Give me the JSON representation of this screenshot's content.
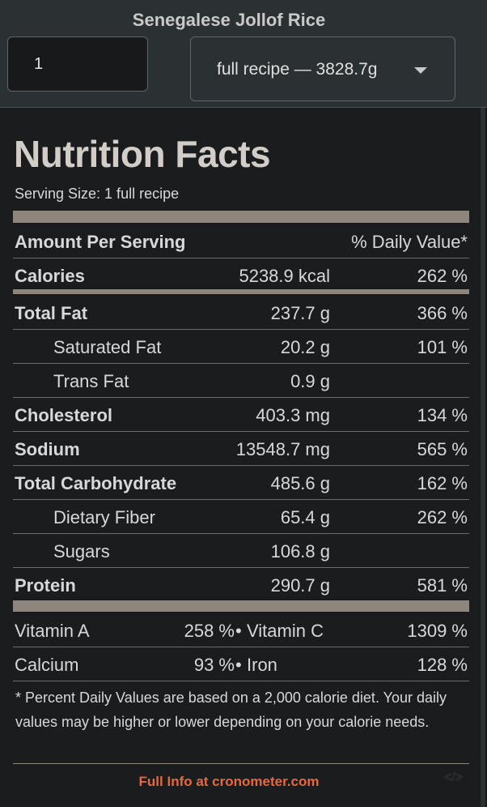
{
  "recipe_title": "Senegalese Jollof Rice",
  "quantity": "1",
  "unit_selected": "full recipe — 3828.7g",
  "label": {
    "title": "Nutrition Facts",
    "serving_size": "Serving Size: 1 full recipe",
    "amount_header": "Amount Per Serving",
    "dv_header": "% Daily Value*",
    "calories": {
      "label": "Calories",
      "amount": "5238.9 kcal",
      "dv": "262 %"
    },
    "nutrients": [
      {
        "label": "Total Fat",
        "amount": "237.7 g",
        "dv": "366 %"
      },
      {
        "label": "Saturated Fat",
        "amount": "20.2 g",
        "dv": "101 %"
      },
      {
        "label": "Trans Fat",
        "amount": "0.9 g",
        "dv": ""
      },
      {
        "label": "Cholesterol",
        "amount": "403.3 mg",
        "dv": "134 %"
      },
      {
        "label": "Sodium",
        "amount": "13548.7 mg",
        "dv": "565 %"
      },
      {
        "label": "Total Carbohydrate",
        "amount": "485.6 g",
        "dv": "162 %"
      },
      {
        "label": "Dietary Fiber",
        "amount": "65.4 g",
        "dv": "262 %"
      },
      {
        "label": "Sugars",
        "amount": "106.8 g",
        "dv": ""
      },
      {
        "label": "Protein",
        "amount": "290.7 g",
        "dv": "581 %"
      }
    ],
    "vitamins": [
      {
        "name1": "Vitamin A",
        "val1": "258 %",
        "name2": "Vitamin C",
        "val2": "1309 %"
      },
      {
        "name1": "Calcium",
        "val1": "93 %",
        "name2": "Iron",
        "val2": "128 %"
      }
    ],
    "separator": "•",
    "footnote": "* Percent Daily Values are based on a 2,000 calorie diet. Your daily values may be higher or lower depending on your calorie needs."
  },
  "footer": {
    "link_text": "Full Info at cronometer.com",
    "embed_icon": "</>"
  },
  "colors": {
    "accent": "#e8683a",
    "rule": "#8e857c",
    "background": "#17191b"
  }
}
